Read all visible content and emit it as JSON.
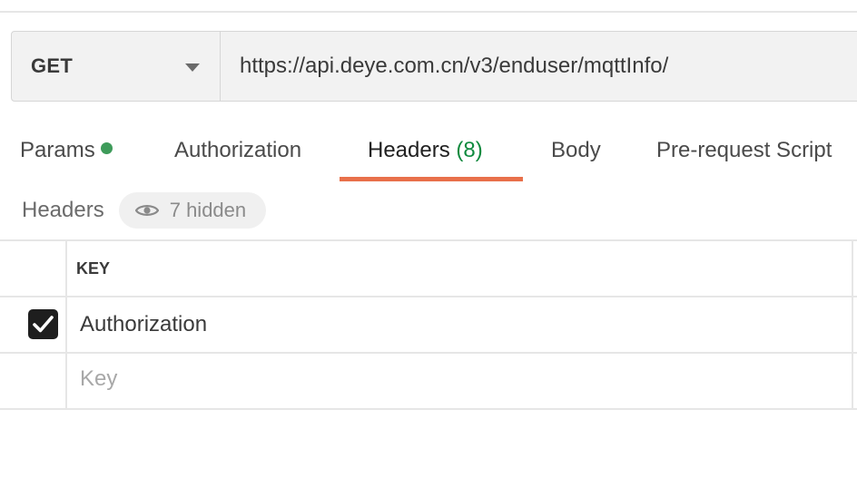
{
  "request": {
    "method": "GET",
    "url": "https://api.deye.com.cn/v3/enduser/mqttInfo/"
  },
  "tabs": [
    {
      "label": "Params",
      "has_dot": true
    },
    {
      "label": "Authorization"
    },
    {
      "label": "Headers",
      "count": "(8)",
      "active": true
    },
    {
      "label": "Body"
    },
    {
      "label": "Pre-request Script"
    }
  ],
  "headers_section": {
    "title": "Headers",
    "hidden_label": "7 hidden"
  },
  "table": {
    "column_key": "KEY",
    "rows": [
      {
        "checked": true,
        "key": "Authorization"
      }
    ],
    "new_row_placeholder": "Key"
  },
  "colors": {
    "active_tab_underline": "#e8704a",
    "count_green": "#0f8a3f",
    "status_dot": "#3e9b5a"
  }
}
